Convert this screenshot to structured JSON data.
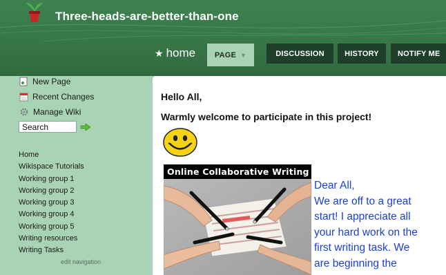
{
  "site": {
    "title": "Three-heads-are-better-than-one"
  },
  "nav": {
    "home_label": "home",
    "tabs": [
      {
        "label": "PAGE"
      },
      {
        "label": "DISCUSSION"
      },
      {
        "label": "HISTORY"
      },
      {
        "label": "NOTIFY ME"
      }
    ]
  },
  "sidebar": {
    "actions": [
      {
        "label": "New Page",
        "icon": "new-page-icon"
      },
      {
        "label": "Recent Changes",
        "icon": "calendar-icon"
      },
      {
        "label": "Manage Wiki",
        "icon": "gear-icon"
      }
    ],
    "search": {
      "value": "Search"
    },
    "links": [
      "Home",
      "Wikispace Tutorials",
      "Working group 1",
      "Working group 2",
      "Working group 3",
      "Working group 4",
      "Working group 5",
      "Writing resources",
      "Writing Tasks"
    ],
    "edit_nav": "edit navigation"
  },
  "content": {
    "greeting": "Hello All,",
    "welcome": "Warmly welcome to participate in this project!",
    "image_caption": "Online Collaborative Writing",
    "message": [
      "Dear All,",
      "We are off to a great",
      "start! I appreciate all",
      "your hard work on the",
      "first writing task. We",
      "are beginning the"
    ]
  },
  "colors": {
    "header_green": "#3a7a4a",
    "sidebar_green": "#a9d3b5",
    "tab_dark": "#1e3f2a",
    "message_blue": "#1b3fd6"
  }
}
